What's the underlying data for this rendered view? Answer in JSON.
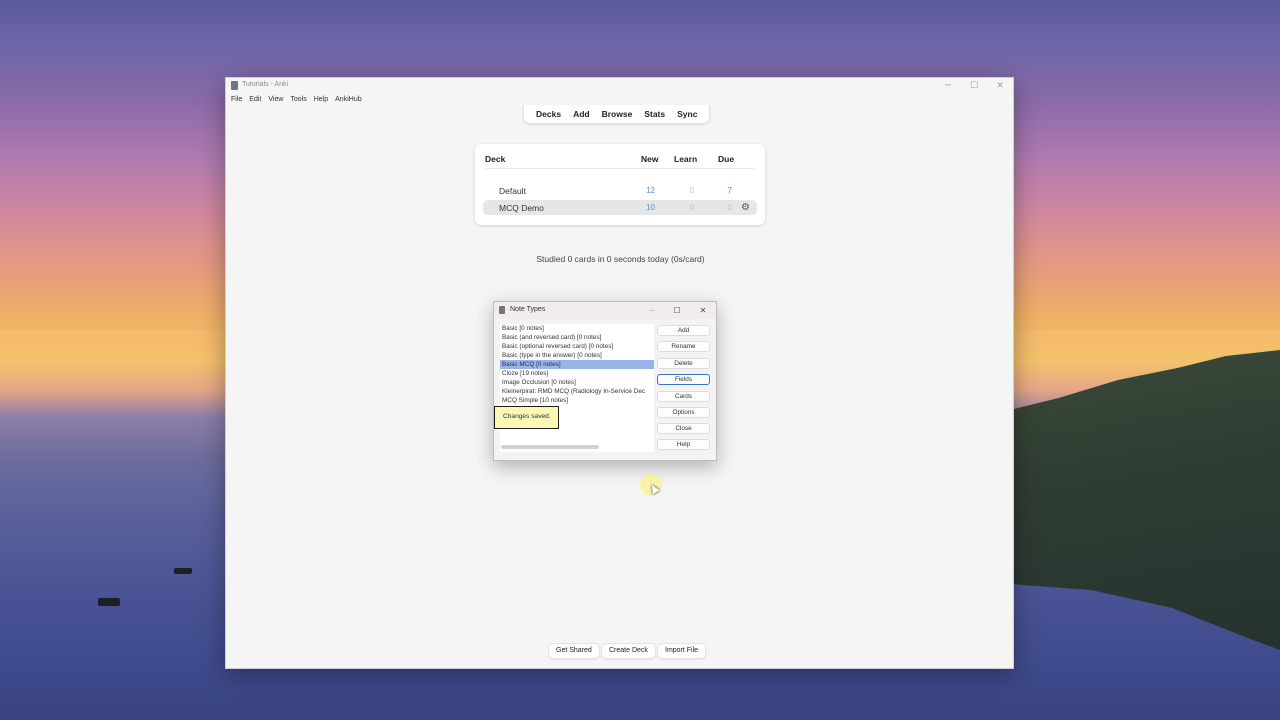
{
  "window": {
    "title": "Tutorials - Anki",
    "controls": {
      "minimize": "─",
      "maximize": "☐",
      "close": "✕"
    }
  },
  "menu": [
    "File",
    "Edit",
    "View",
    "Tools",
    "Help",
    "AnkiHub"
  ],
  "toolbar": [
    "Decks",
    "Add",
    "Browse",
    "Stats",
    "Sync"
  ],
  "deck_table": {
    "headers": {
      "deck": "Deck",
      "new": "New",
      "learn": "Learn",
      "due": "Due"
    },
    "rows": [
      {
        "name": "Default",
        "new": "12",
        "learn": "0",
        "due": "7"
      },
      {
        "name": "MCQ Demo",
        "new": "10",
        "learn": "0",
        "due": "0"
      }
    ]
  },
  "studied": "Studied 0 cards in 0 seconds today (0s/card)",
  "bottom_buttons": {
    "get_shared": "Get Shared",
    "create_deck": "Create Deck",
    "import_file": "Import File"
  },
  "dialog": {
    "title": "Note Types",
    "controls": {
      "minimize": "─",
      "maximize": "☐",
      "close": "✕"
    },
    "note_types": [
      "Basic [0 notes]",
      "Basic (and reversed card) [0 notes]",
      "Basic (optional reversed card) [0 notes]",
      "Basic (type in the answer) [0 notes]",
      "Basic MCQ [0 notes]",
      "Cloze [19 notes]",
      "Image Occlusion [0 notes]",
      "Kleinerpirat: RMD MCQ  (Radiology In-Service Dec",
      "MCQ Simple [10 notes]"
    ],
    "selected_index": 4,
    "buttons": {
      "add": "Add",
      "rename": "Rename",
      "delete": "Delete",
      "fields": "Fields",
      "cards": "Cards",
      "options": "Options",
      "close": "Close",
      "help": "Help"
    },
    "tooltip": "Changes saved."
  },
  "icons": {
    "gear": "gear-icon",
    "app": "anki-icon"
  }
}
